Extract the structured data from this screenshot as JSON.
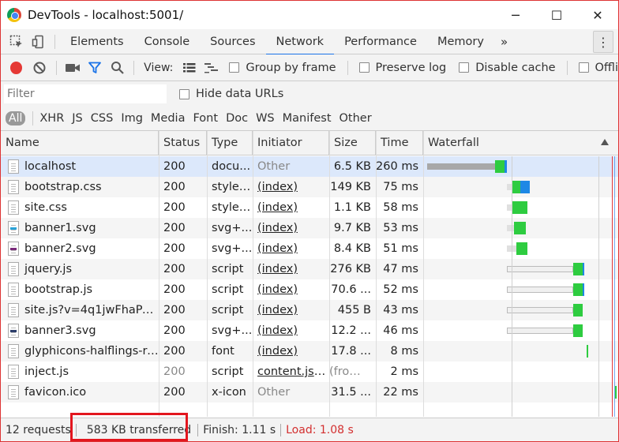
{
  "window": {
    "title": "DevTools - localhost:5001/",
    "controls": {
      "minimize": "─",
      "maximize": "☐",
      "close": "✕"
    }
  },
  "tabs": [
    {
      "label": "Elements",
      "active": false
    },
    {
      "label": "Console",
      "active": false
    },
    {
      "label": "Sources",
      "active": false
    },
    {
      "label": "Network",
      "active": true
    },
    {
      "label": "Performance",
      "active": false
    },
    {
      "label": "Memory",
      "active": false
    }
  ],
  "tabs_more": "»",
  "toolbar": {
    "view_label": "View:",
    "group_by_frame": "Group by frame",
    "preserve_log": "Preserve log",
    "disable_cache": "Disable cache",
    "offline": "Offli"
  },
  "filter": {
    "placeholder": "Filter",
    "hide_data_urls": "Hide data URLs"
  },
  "type_filters": [
    "All",
    "XHR",
    "JS",
    "CSS",
    "Img",
    "Media",
    "Font",
    "Doc",
    "WS",
    "Manifest",
    "Other"
  ],
  "columns": {
    "name": "Name",
    "status": "Status",
    "type": "Type",
    "initiator": "Initiator",
    "size": "Size",
    "time": "Time",
    "waterfall": "Waterfall"
  },
  "requests": [
    {
      "name": "localhost",
      "status": "200",
      "type": "docu...",
      "initiator": "Other",
      "initiator_style": "dim",
      "size": "6.5 KB",
      "time": "260 ms",
      "icon": "document",
      "selected": true,
      "wf": [
        {
          "from": 0.0,
          "to": 0.36,
          "color": "#a8a8a8"
        },
        {
          "from": 0.36,
          "to": 0.41,
          "color": "#2ecc40"
        },
        {
          "from": 0.41,
          "to": 0.42,
          "color": "#1e88e5"
        }
      ]
    },
    {
      "name": "bootstrap.css",
      "status": "200",
      "type": "styles...",
      "initiator": "(index)",
      "initiator_style": "link",
      "size": "149 KB",
      "time": "75 ms",
      "icon": "document",
      "wf": [
        {
          "from": 0.42,
          "to": 0.45,
          "color": "#e0e0e0"
        },
        {
          "from": 0.45,
          "to": 0.49,
          "color": "#2ecc40"
        },
        {
          "from": 0.49,
          "to": 0.54,
          "color": "#1e88e5"
        }
      ]
    },
    {
      "name": "site.css",
      "status": "200",
      "type": "styles...",
      "initiator": "(index)",
      "initiator_style": "link",
      "size": "1.1 KB",
      "time": "58 ms",
      "icon": "document",
      "wf": [
        {
          "from": 0.42,
          "to": 0.45,
          "color": "#e0e0e0"
        },
        {
          "from": 0.45,
          "to": 0.53,
          "color": "#2ecc40"
        }
      ]
    },
    {
      "name": "banner1.svg",
      "status": "200",
      "type": "svg+...",
      "initiator": "(index)",
      "initiator_style": "link",
      "size": "9.7 KB",
      "time": "53 ms",
      "icon": "svg-blue",
      "wf": [
        {
          "from": 0.42,
          "to": 0.46,
          "color": "#e0e0e0"
        },
        {
          "from": 0.46,
          "to": 0.52,
          "color": "#2ecc40"
        }
      ]
    },
    {
      "name": "banner2.svg",
      "status": "200",
      "type": "svg+...",
      "initiator": "(index)",
      "initiator_style": "link",
      "size": "8.4 KB",
      "time": "51 ms",
      "icon": "svg-purple",
      "wf": [
        {
          "from": 0.42,
          "to": 0.47,
          "color": "#e0e0e0"
        },
        {
          "from": 0.47,
          "to": 0.53,
          "color": "#2ecc40"
        }
      ]
    },
    {
      "name": "jquery.js",
      "status": "200",
      "type": "script",
      "initiator": "(index)",
      "initiator_style": "link",
      "size": "276 KB",
      "time": "47 ms",
      "icon": "document",
      "wf": [
        {
          "from": 0.42,
          "to": 0.77,
          "color": "#f0f0f0",
          "outline": true
        },
        {
          "from": 0.77,
          "to": 0.82,
          "color": "#2ecc40"
        },
        {
          "from": 0.82,
          "to": 0.83,
          "color": "#1e88e5"
        }
      ]
    },
    {
      "name": "bootstrap.js",
      "status": "200",
      "type": "script",
      "initiator": "(index)",
      "initiator_style": "link",
      "size": "70.6 ...",
      "time": "52 ms",
      "icon": "document",
      "wf": [
        {
          "from": 0.42,
          "to": 0.77,
          "color": "#f0f0f0",
          "outline": true
        },
        {
          "from": 0.77,
          "to": 0.82,
          "color": "#2ecc40"
        },
        {
          "from": 0.82,
          "to": 0.83,
          "color": "#1e88e5"
        }
      ]
    },
    {
      "name": "site.js?v=4q1jwFhaPaZ...",
      "status": "200",
      "type": "script",
      "initiator": "(index)",
      "initiator_style": "link",
      "size": "455 B",
      "time": "43 ms",
      "icon": "document",
      "wf": [
        {
          "from": 0.42,
          "to": 0.77,
          "color": "#f0f0f0",
          "outline": true
        },
        {
          "from": 0.77,
          "to": 0.82,
          "color": "#2ecc40"
        }
      ]
    },
    {
      "name": "banner3.svg",
      "status": "200",
      "type": "svg+...",
      "initiator": "(index)",
      "initiator_style": "link",
      "size": "12.2 ...",
      "time": "46 ms",
      "icon": "svg-dark",
      "wf": [
        {
          "from": 0.42,
          "to": 0.77,
          "color": "#f0f0f0",
          "outline": true
        },
        {
          "from": 0.77,
          "to": 0.82,
          "color": "#2ecc40"
        }
      ]
    },
    {
      "name": "glyphicons-halflings-re...",
      "status": "200",
      "type": "font",
      "initiator": "(index)",
      "initiator_style": "link",
      "size": "17.8 ...",
      "time": "8 ms",
      "icon": "document",
      "wf": [
        {
          "from": 0.84,
          "to": 0.85,
          "color": "#2ecc40"
        }
      ]
    },
    {
      "name": "inject.js",
      "status": "200",
      "status_style": "dim",
      "type": "script",
      "initiator": "content.js:55",
      "initiator_style": "link",
      "size": "(from...",
      "size_style": "dim",
      "time": "2 ms",
      "icon": "document",
      "wf": []
    },
    {
      "name": "favicon.ico",
      "status": "200",
      "type": "x-icon",
      "initiator": "Other",
      "initiator_style": "dim",
      "size": "31.5 ...",
      "time": "22 ms",
      "icon": "document",
      "wf": [
        {
          "from": 0.99,
          "to": 1.0,
          "color": "#2ecc40"
        }
      ]
    }
  ],
  "status_bar": {
    "requests": "12 requests",
    "transferred": "583 KB transferred",
    "finish": "Finish: 1.11 s",
    "load": "Load: 1.08 s"
  },
  "colors": {
    "accent": "#1a73e8",
    "record": "#e53935",
    "load": "#d32f2f",
    "highlight": "#e3161e"
  }
}
